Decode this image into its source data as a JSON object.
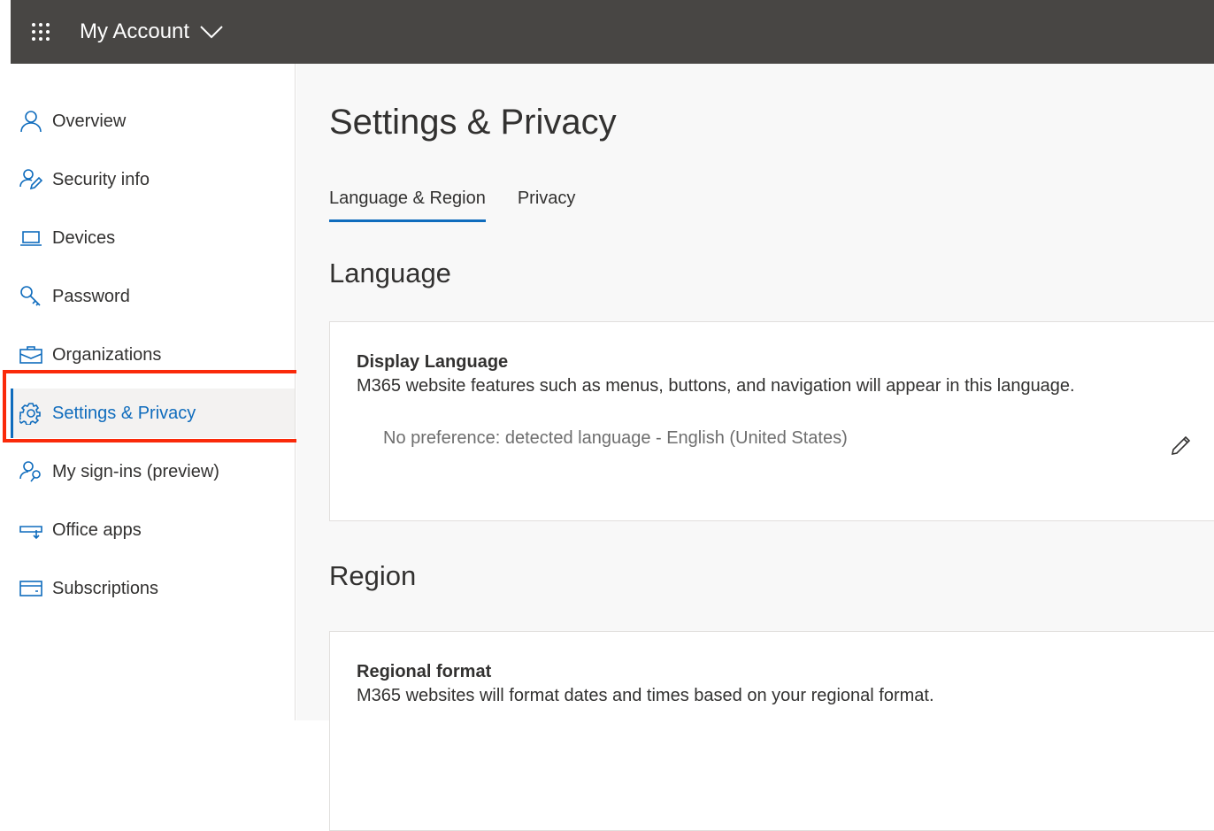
{
  "header": {
    "title": "My Account",
    "app_launcher_icon": "waffle-icon",
    "dropdown_icon": "chevron-down-icon"
  },
  "sidebar": {
    "items": [
      {
        "label": "Overview",
        "icon": "person-icon"
      },
      {
        "label": "Security info",
        "icon": "person-edit-icon"
      },
      {
        "label": "Devices",
        "icon": "laptop-icon"
      },
      {
        "label": "Password",
        "icon": "key-icon"
      },
      {
        "label": "Organizations",
        "icon": "briefcase-icon"
      },
      {
        "label": "Settings & Privacy",
        "icon": "gear-icon",
        "active": true
      },
      {
        "label": "My sign-ins (preview)",
        "icon": "person-key-icon"
      },
      {
        "label": "Office apps",
        "icon": "install-icon"
      },
      {
        "label": "Subscriptions",
        "icon": "card-icon"
      }
    ]
  },
  "main": {
    "title": "Settings & Privacy",
    "tabs": [
      {
        "label": "Language & Region",
        "active": true
      },
      {
        "label": "Privacy"
      }
    ],
    "language": {
      "heading": "Language",
      "card_title": "Display Language",
      "card_desc": "M365 website features such as menus, buttons, and navigation will appear in this language.",
      "value": "No preference: detected language - English (United States)"
    },
    "region": {
      "heading": "Region",
      "card_title": "Regional format",
      "card_desc": "M365 websites will format dates and times based on your regional format."
    }
  },
  "colors": {
    "accent": "#0f6cbd",
    "header_bg": "#484644",
    "highlight": "#fa2a0a"
  }
}
